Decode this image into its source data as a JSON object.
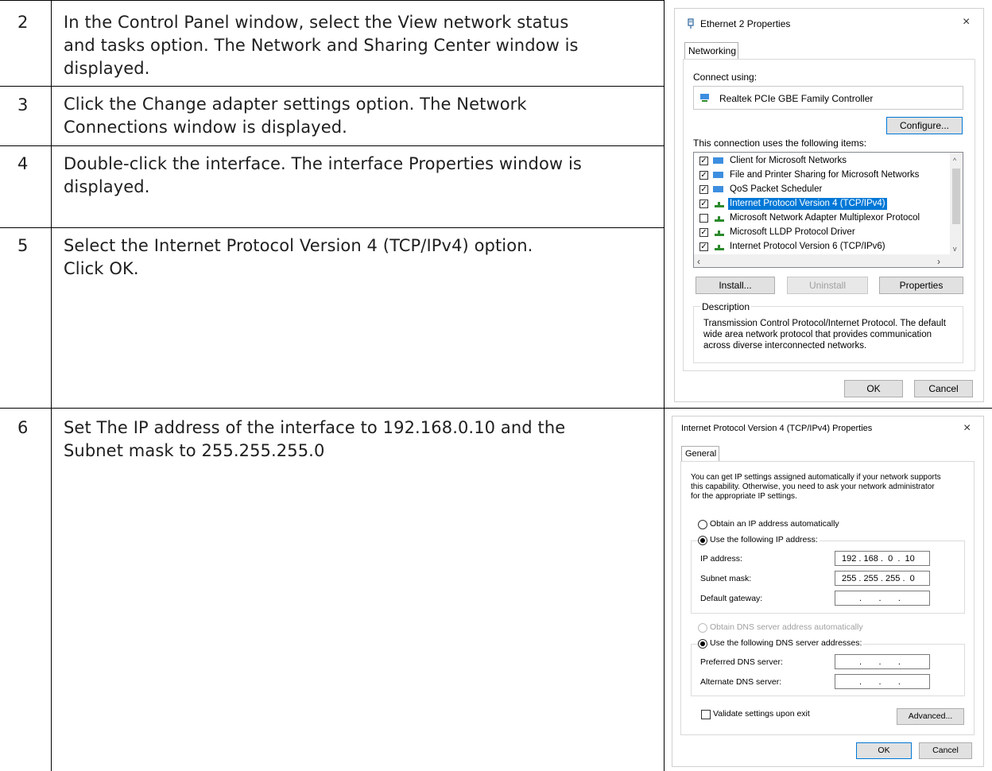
{
  "steps": [
    {
      "num": "2",
      "lines": [
        "In the Control Panel window, select the View network status",
        "and tasks option. The Network and Sharing Center window is",
        "displayed."
      ]
    },
    {
      "num": "3",
      "lines": [
        "Click the Change adapter settings option. The Network",
        "Connections window is displayed."
      ]
    },
    {
      "num": "4",
      "lines": [
        "Double-click the interface. The interface Properties window is",
        "displayed."
      ]
    },
    {
      "num": "5",
      "lines": [
        "Select the Internet Protocol Version 4 (TCP/IPv4) option.",
        "Click OK."
      ]
    },
    {
      "num": "6",
      "lines": [
        "Set The IP address of the interface to 192.168.0.10 and the",
        "Subnet mask to 255.255.255.0"
      ]
    }
  ],
  "ethernet_dialog": {
    "title": "Ethernet 2 Properties",
    "close": "×",
    "tab": "Networking",
    "connect_using_label": "Connect using:",
    "adapter": "Realtek PCIe GBE Family Controller",
    "configure_button": "Configure...",
    "items_label": "This connection uses the following items:",
    "items": [
      {
        "label": "Client for Microsoft Networks",
        "checked": true,
        "selected": false
      },
      {
        "label": "File and Printer Sharing for Microsoft Networks",
        "checked": true,
        "selected": false
      },
      {
        "label": "QoS Packet Scheduler",
        "checked": true,
        "selected": false
      },
      {
        "label": "Internet Protocol Version 4 (TCP/IPv4)",
        "checked": true,
        "selected": true
      },
      {
        "label": "Microsoft Network Adapter Multiplexor Protocol",
        "checked": false,
        "selected": false
      },
      {
        "label": "Microsoft LLDP Protocol Driver",
        "checked": true,
        "selected": false
      },
      {
        "label": "Internet Protocol Version 6 (TCP/IPv6)",
        "checked": true,
        "selected": false
      }
    ],
    "install_button": "Install...",
    "uninstall_button": "Uninstall",
    "properties_button": "Properties",
    "description_label": "Description",
    "description_lines": [
      "Transmission Control Protocol/Internet Protocol. The default",
      "wide area network protocol that provides communication",
      "across diverse interconnected networks."
    ],
    "ok_button": "OK",
    "cancel_button": "Cancel"
  },
  "ipv4_dialog": {
    "title": "Internet Protocol Version 4 (TCP/IPv4) Properties",
    "close": "×",
    "tab": "General",
    "intro_lines": [
      "You can get IP settings assigned automatically if your network supports",
      "this capability. Otherwise, you need to ask your network administrator",
      "for the appropriate IP settings."
    ],
    "obtain_ip_auto": "Obtain an IP address automatically",
    "use_following_ip": "Use the following IP address:",
    "ip_address_label": "IP address:",
    "ip_address_value": "192 . 168 .  0  .  10",
    "subnet_mask_label": "Subnet mask:",
    "subnet_mask_value": "255 . 255 . 255 .  0",
    "default_gateway_label": "Default gateway:",
    "default_gateway_value": ".       .       .",
    "obtain_dns_auto": "Obtain DNS server address automatically",
    "use_following_dns": "Use the following DNS server addresses:",
    "preferred_dns_label": "Preferred DNS server:",
    "preferred_dns_value": ".       .       .",
    "alternate_dns_label": "Alternate DNS server:",
    "alternate_dns_value": ".       .       .",
    "validate_label": "Validate settings upon exit",
    "advanced_button": "Advanced...",
    "ok_button": "OK",
    "cancel_button": "Cancel"
  }
}
